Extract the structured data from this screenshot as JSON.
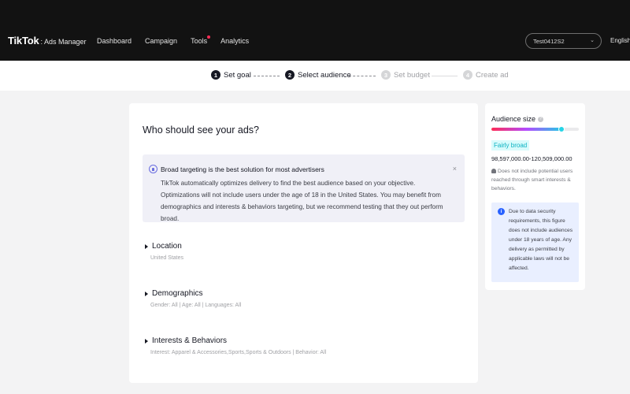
{
  "header": {
    "brand": "TikTok",
    "brand_sub": ": Ads Manager",
    "nav": [
      "Dashboard",
      "Campaign",
      "Tools",
      "Analytics"
    ],
    "account": "Test0412S2",
    "language": "English"
  },
  "steps": [
    {
      "num": "1",
      "label": "Set goal"
    },
    {
      "num": "2",
      "label": "Select audience"
    },
    {
      "num": "3",
      "label": "Set budget"
    },
    {
      "num": "4",
      "label": "Create ad"
    }
  ],
  "main": {
    "title": "Who should see your ads?",
    "banner": {
      "title": "Broad targeting is the best solution for most advertisers",
      "body": "TikTok automatically optimizes delivery to find the best audience based on your objective. Optimizations will not include users under the age of 18 in the United States. You may benefit from demographics and interests & behaviors targeting, but we recommend testing that they out perform broad.",
      "close": "×"
    },
    "sections": [
      {
        "title": "Location",
        "summary": "United States"
      },
      {
        "title": "Demographics",
        "summary": "Gender: All | Age: All | Languages: All"
      },
      {
        "title": "Interests & Behaviors",
        "summary": "Interest: Apparel & Accessories,Sports,Sports & Outdoors | Behavior: All"
      }
    ]
  },
  "audience": {
    "title": "Audience size",
    "level": 0.8,
    "tag": "Fairly broad",
    "range": "98,597,000.00-120,509,000.00",
    "note": "Does not include potential users reached through smart interests & behaviors.",
    "info": "Due to data security requirements, this figure does not include audiences under 18 years of age. Any delivery as permitted by applicable laws will not be affected."
  },
  "colors": {
    "topbar": "#121212",
    "accent_red": "#fe2c55",
    "accent_cyan": "#25d4e6",
    "info_blue": "#2962ff"
  }
}
